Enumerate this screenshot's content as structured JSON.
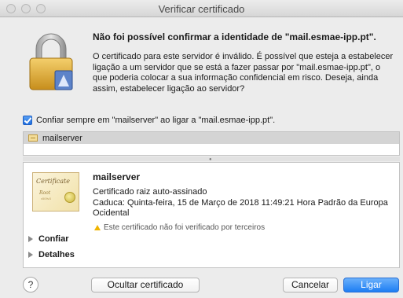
{
  "window": {
    "title": "Verificar certificado"
  },
  "dialog": {
    "headline": "Não foi possível confirmar a identidade de \"mail.esmae-ipp.pt\".",
    "message": "O certificado para este servidor é inválido. É possível que esteja a estabelecer ligação a um servidor que se está a fazer passar por \"mail.esmae-ipp.pt\", o que poderia colocar a sua informação confidencial em risco. Deseja, ainda assim, estabelecer ligação ao servidor?",
    "lock_icon": "lock-icon"
  },
  "trust": {
    "checked": true,
    "label": "Confiar sempre em \"mailserver\" ao ligar a \"mail.esmae-ipp.pt\"."
  },
  "cert_list": {
    "items": [
      {
        "label": "mailserver",
        "icon": "certificate-icon"
      }
    ]
  },
  "cert_detail": {
    "thumb_title": "Certificate",
    "thumb_subtitle": "Root",
    "thumb_small": "x509v3",
    "name": "mailserver",
    "type": "Certificado raiz auto-assinado",
    "expiry": "Caduca: Quinta-feira, 15 de Março de 2018 11:49:21 Hora Padrão da Europa Ocidental",
    "warning": "Este certificado não foi verificado por terceiros",
    "sections": [
      "Confiar",
      "Detalhes"
    ]
  },
  "buttons": {
    "help": "?",
    "hide_certificate": "Ocultar certificado",
    "cancel": "Cancelar",
    "connect": "Ligar"
  },
  "colors": {
    "accent": "#1d7df3",
    "warning": "#f0b400",
    "selection": "#d4d4d4"
  }
}
